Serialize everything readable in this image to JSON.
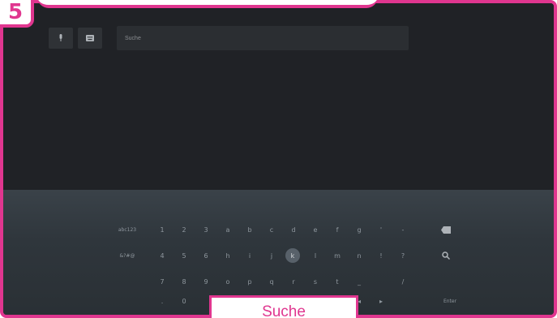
{
  "step": {
    "number": "5"
  },
  "search": {
    "placeholder": "Suche"
  },
  "keyboard": {
    "row1": [
      "1",
      "2",
      "3",
      "a",
      "b",
      "c",
      "d",
      "e",
      "f",
      "g",
      "'",
      "-"
    ],
    "row2": [
      "4",
      "5",
      "6",
      "h",
      "i",
      "j",
      "k",
      "l",
      "m",
      "n",
      "!",
      "?"
    ],
    "row3": [
      "7",
      "8",
      "9",
      "o",
      "p",
      "q",
      "r",
      "s",
      "t",
      "_",
      "",
      "/"
    ],
    "row4": [
      ".",
      "0",
      "",
      "",
      "",
      "",
      "",
      "",
      "•",
      "◂",
      "▸"
    ],
    "mode_abc": "abc123",
    "mode_sym": "&?#@",
    "enter": "Enter",
    "focused_key": "k"
  },
  "caption": {
    "label": "Suche"
  },
  "colors": {
    "accent": "#e0368f",
    "screen": "#202226",
    "keyboard": "#323a40"
  }
}
